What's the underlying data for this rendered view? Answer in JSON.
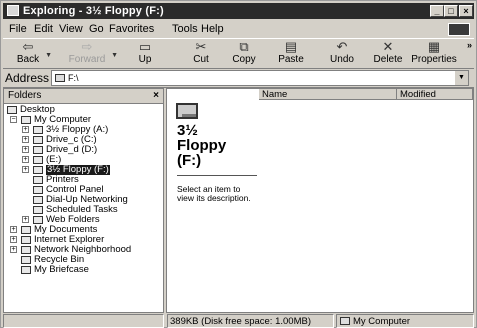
{
  "window": {
    "title": "Exploring - 3½ Floppy (F:)"
  },
  "title_buttons": {
    "minimize": "_",
    "maximize": "□",
    "close": "×"
  },
  "menu": [
    "File",
    "Edit",
    "View",
    "Go",
    "Favorites",
    "Tools",
    "Help"
  ],
  "toolbar": {
    "back": "Back",
    "forward": "Forward",
    "up": "Up",
    "cut": "Cut",
    "copy": "Copy",
    "paste": "Paste",
    "undo": "Undo",
    "delete": "Delete",
    "properties": "Properties",
    "more": "»"
  },
  "address": {
    "label": "Address",
    "value": "F:\\"
  },
  "folders_pane": {
    "title": "Folders",
    "close": "×",
    "tree": [
      {
        "label": "Desktop",
        "expander": ""
      },
      {
        "label": "My Computer",
        "expander": "−"
      },
      {
        "label": "3½ Floppy (A:)",
        "expander": "+"
      },
      {
        "label": "Drive_c (C:)",
        "expander": "+"
      },
      {
        "label": "Drive_d (D:)",
        "expander": "+"
      },
      {
        "label": "(E:)",
        "expander": "+"
      },
      {
        "label": "3½ Floppy (F:)",
        "expander": "+"
      },
      {
        "label": "Printers",
        "expander": ""
      },
      {
        "label": "Control Panel",
        "expander": ""
      },
      {
        "label": "Dial-Up Networking",
        "expander": ""
      },
      {
        "label": "Scheduled Tasks",
        "expander": ""
      },
      {
        "label": "Web Folders",
        "expander": "+"
      },
      {
        "label": "My Documents",
        "expander": "+"
      },
      {
        "label": "Internet Explorer",
        "expander": "+"
      },
      {
        "label": "Network Neighborhood",
        "expander": "+"
      },
      {
        "label": "Recycle Bin",
        "expander": ""
      },
      {
        "label": "My Briefcase",
        "expander": ""
      }
    ]
  },
  "content": {
    "columns": [
      "Name",
      "Modified"
    ],
    "title": "3½ Floppy (F:)",
    "title_lines": [
      "3½",
      "Floppy",
      "(F:)"
    ],
    "description": "Select an item to view its description."
  },
  "statusbar": {
    "left": "",
    "middle": "389KB (Disk free space: 1.00MB)",
    "right": "My Computer"
  }
}
